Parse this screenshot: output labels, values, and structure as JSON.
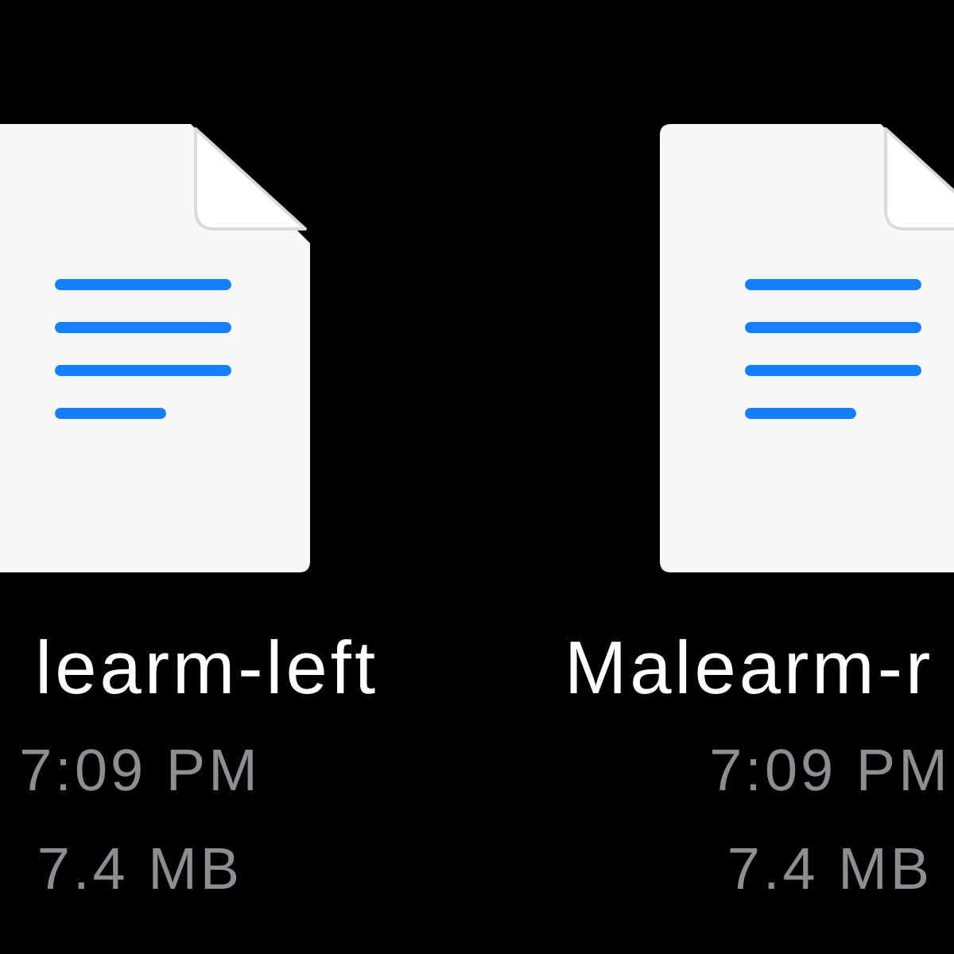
{
  "files": [
    {
      "name": "learm-left",
      "time": "7:09 PM",
      "size": "7.4 MB"
    },
    {
      "name": "Malearm-r",
      "time": "7:09 PM",
      "size": "7.4 MB"
    }
  ]
}
